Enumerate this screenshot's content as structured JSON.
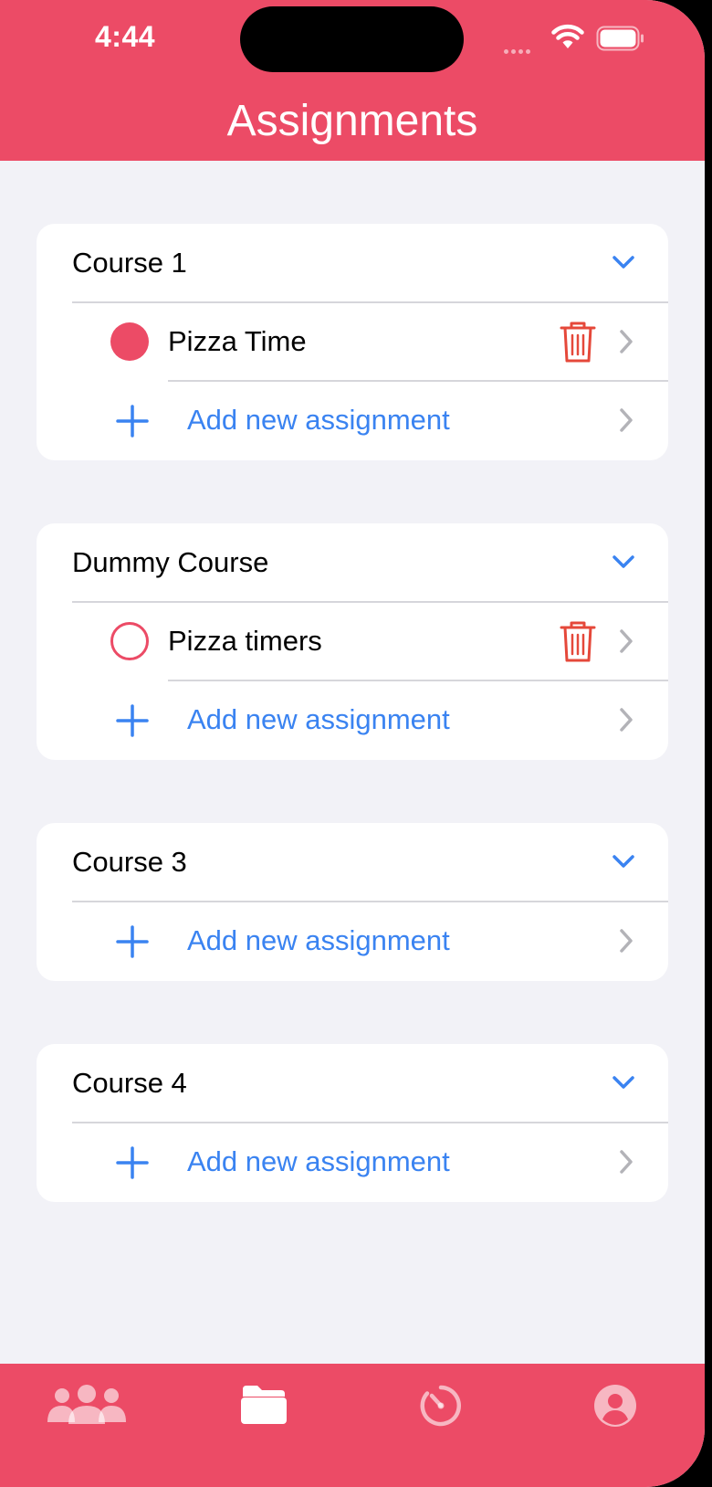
{
  "status_bar": {
    "time": "4:44"
  },
  "nav": {
    "title": "Assignments"
  },
  "colors": {
    "accent": "#ec4b66",
    "link": "#3a83f1",
    "delete": "#e5483a",
    "background": "#f2f2f7"
  },
  "courses": [
    {
      "name": "Course 1",
      "assignments": [
        {
          "name": "Pizza Time",
          "completed": true
        }
      ],
      "add_label": "Add new assignment"
    },
    {
      "name": "Dummy Course",
      "assignments": [
        {
          "name": "Pizza timers",
          "completed": false
        }
      ],
      "add_label": "Add new assignment"
    },
    {
      "name": "Course 3",
      "assignments": [],
      "add_label": "Add new assignment"
    },
    {
      "name": "Course 4",
      "assignments": [],
      "add_label": "Add new assignment"
    }
  ],
  "tab_bar": {
    "tabs": [
      {
        "icon": "people-icon",
        "selected": false
      },
      {
        "icon": "folder-icon",
        "selected": true
      },
      {
        "icon": "timer-icon",
        "selected": false
      },
      {
        "icon": "profile-icon",
        "selected": false
      }
    ]
  }
}
